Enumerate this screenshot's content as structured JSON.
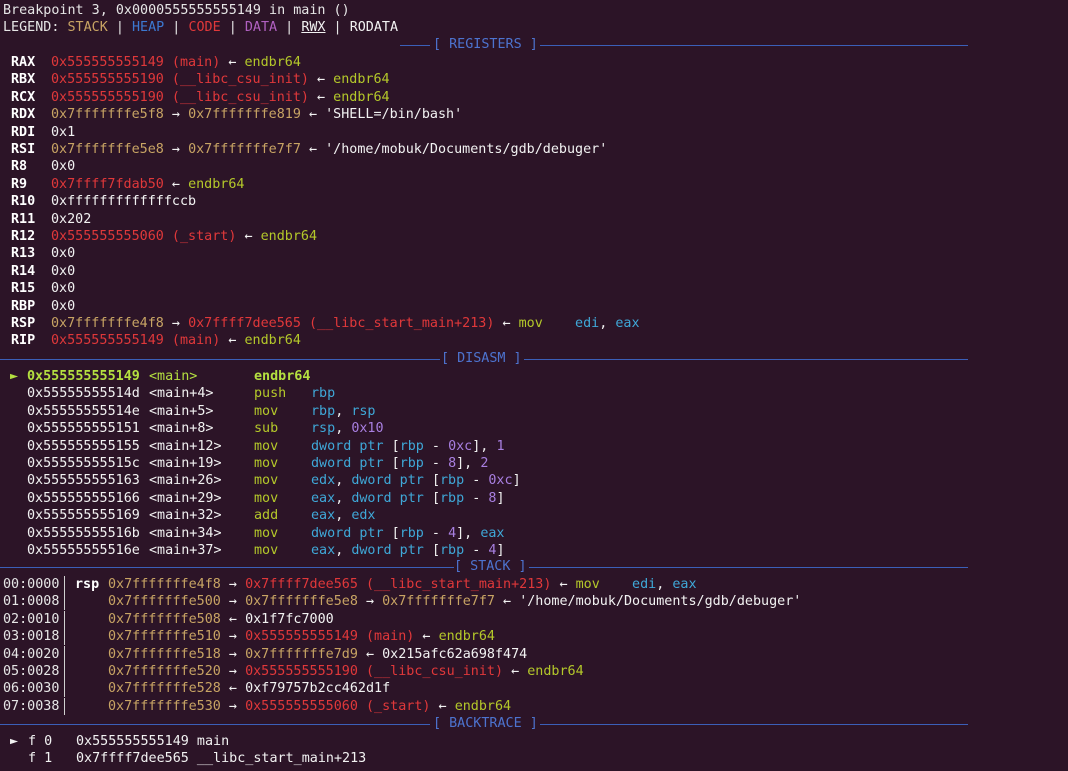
{
  "header": {
    "breakpoint_line": "Breakpoint 3, 0x0000555555555149 in main ()",
    "legend_prefix": "LEGEND: ",
    "legend": {
      "stack": "STACK",
      "heap": "HEAP",
      "code": "CODE",
      "data": "DATA",
      "rwx": "RWX",
      "rodata": "RODATA",
      "separator": " | "
    }
  },
  "sections": {
    "registers": "[ REGISTERS ]",
    "disasm": "[ DISASM ]",
    "stack": "[ STACK ]",
    "backtrace": "[ BACKTRACE ]"
  },
  "registers": [
    {
      "name": "RAX",
      "parts": [
        {
          "t": "0x555555555149 (main)",
          "c": "red"
        },
        {
          "t": " ← ",
          "c": "white"
        },
        {
          "t": "endbr64",
          "c": "green"
        }
      ]
    },
    {
      "name": "RBX",
      "parts": [
        {
          "t": "0x555555555190 (__libc_csu_init)",
          "c": "red"
        },
        {
          "t": " ← ",
          "c": "white"
        },
        {
          "t": "endbr64",
          "c": "green"
        }
      ]
    },
    {
      "name": "RCX",
      "parts": [
        {
          "t": "0x555555555190 (__libc_csu_init)",
          "c": "red"
        },
        {
          "t": " ← ",
          "c": "white"
        },
        {
          "t": "endbr64",
          "c": "green"
        }
      ]
    },
    {
      "name": "RDX",
      "parts": [
        {
          "t": "0x7fffffffe5f8",
          "c": "brown"
        },
        {
          "t": " → ",
          "c": "white"
        },
        {
          "t": "0x7fffffffe819",
          "c": "brown"
        },
        {
          "t": " ← ",
          "c": "white"
        },
        {
          "t": "'SHELL=/bin/bash'",
          "c": "white"
        }
      ]
    },
    {
      "name": "RDI",
      "parts": [
        {
          "t": "0x1",
          "c": "white"
        }
      ]
    },
    {
      "name": "RSI",
      "parts": [
        {
          "t": "0x7fffffffe5e8",
          "c": "brown"
        },
        {
          "t": " → ",
          "c": "white"
        },
        {
          "t": "0x7fffffffe7f7",
          "c": "brown"
        },
        {
          "t": " ← ",
          "c": "white"
        },
        {
          "t": "'/home/mobuk/Documents/gdb/debuger'",
          "c": "white"
        }
      ]
    },
    {
      "name": "R8",
      "parts": [
        {
          "t": "0x0",
          "c": "white"
        }
      ]
    },
    {
      "name": "R9",
      "parts": [
        {
          "t": "0x7ffff7fdab50",
          "c": "red"
        },
        {
          "t": " ← ",
          "c": "white"
        },
        {
          "t": "endbr64",
          "c": "green"
        }
      ]
    },
    {
      "name": "R10",
      "parts": [
        {
          "t": "0xfffffffffffffccb",
          "c": "white"
        }
      ]
    },
    {
      "name": "R11",
      "parts": [
        {
          "t": "0x202",
          "c": "white"
        }
      ]
    },
    {
      "name": "R12",
      "parts": [
        {
          "t": "0x555555555060 (_start)",
          "c": "red"
        },
        {
          "t": " ← ",
          "c": "white"
        },
        {
          "t": "endbr64",
          "c": "green"
        }
      ]
    },
    {
      "name": "R13",
      "parts": [
        {
          "t": "0x0",
          "c": "white"
        }
      ]
    },
    {
      "name": "R14",
      "parts": [
        {
          "t": "0x0",
          "c": "white"
        }
      ]
    },
    {
      "name": "R15",
      "parts": [
        {
          "t": "0x0",
          "c": "white"
        }
      ]
    },
    {
      "name": "RBP",
      "parts": [
        {
          "t": "0x0",
          "c": "white"
        }
      ]
    },
    {
      "name": "RSP",
      "parts": [
        {
          "t": "0x7fffffffe4f8",
          "c": "brown"
        },
        {
          "t": " → ",
          "c": "white"
        },
        {
          "t": "0x7ffff7dee565 (__libc_start_main+213)",
          "c": "red"
        },
        {
          "t": " ← ",
          "c": "white"
        },
        {
          "t": "mov",
          "c": "green"
        },
        {
          "t": "    ",
          "c": "white"
        },
        {
          "t": "edi",
          "c": "cyan"
        },
        {
          "t": ", ",
          "c": "white"
        },
        {
          "t": "eax",
          "c": "cyan"
        }
      ]
    },
    {
      "name": "RIP",
      "parts": [
        {
          "t": "0x555555555149 (main)",
          "c": "red"
        },
        {
          "t": " ← ",
          "c": "white"
        },
        {
          "t": "endbr64",
          "c": "green"
        }
      ]
    }
  ],
  "disasm": [
    {
      "current": true,
      "addr": "0x555555555149",
      "sym": "<main>",
      "mnem": "endbr64",
      "ops": []
    },
    {
      "current": false,
      "addr": "0x55555555514d",
      "sym": "<main+4>",
      "mnem": "push",
      "ops": [
        {
          "t": "rbp",
          "c": "cyan"
        }
      ]
    },
    {
      "current": false,
      "addr": "0x55555555514e",
      "sym": "<main+5>",
      "mnem": "mov",
      "ops": [
        {
          "t": "rbp",
          "c": "cyan"
        },
        {
          "t": ", ",
          "c": "white"
        },
        {
          "t": "rsp",
          "c": "cyan"
        }
      ]
    },
    {
      "current": false,
      "addr": "0x555555555151",
      "sym": "<main+8>",
      "mnem": "sub",
      "ops": [
        {
          "t": "rsp",
          "c": "cyan"
        },
        {
          "t": ", ",
          "c": "white"
        },
        {
          "t": "0x10",
          "c": "purple"
        }
      ]
    },
    {
      "current": false,
      "addr": "0x555555555155",
      "sym": "<main+12>",
      "mnem": "mov",
      "ops": [
        {
          "t": "dword ptr ",
          "c": "cyan"
        },
        {
          "t": "[",
          "c": "white"
        },
        {
          "t": "rbp",
          "c": "cyan"
        },
        {
          "t": " - ",
          "c": "white"
        },
        {
          "t": "0xc",
          "c": "purple"
        },
        {
          "t": "], ",
          "c": "white"
        },
        {
          "t": "1",
          "c": "purple"
        }
      ]
    },
    {
      "current": false,
      "addr": "0x55555555515c",
      "sym": "<main+19>",
      "mnem": "mov",
      "ops": [
        {
          "t": "dword ptr ",
          "c": "cyan"
        },
        {
          "t": "[",
          "c": "white"
        },
        {
          "t": "rbp",
          "c": "cyan"
        },
        {
          "t": " - ",
          "c": "white"
        },
        {
          "t": "8",
          "c": "purple"
        },
        {
          "t": "], ",
          "c": "white"
        },
        {
          "t": "2",
          "c": "purple"
        }
      ]
    },
    {
      "current": false,
      "addr": "0x555555555163",
      "sym": "<main+26>",
      "mnem": "mov",
      "ops": [
        {
          "t": "edx",
          "c": "cyan"
        },
        {
          "t": ", ",
          "c": "white"
        },
        {
          "t": "dword ptr ",
          "c": "cyan"
        },
        {
          "t": "[",
          "c": "white"
        },
        {
          "t": "rbp",
          "c": "cyan"
        },
        {
          "t": " - ",
          "c": "white"
        },
        {
          "t": "0xc",
          "c": "purple"
        },
        {
          "t": "]",
          "c": "white"
        }
      ]
    },
    {
      "current": false,
      "addr": "0x555555555166",
      "sym": "<main+29>",
      "mnem": "mov",
      "ops": [
        {
          "t": "eax",
          "c": "cyan"
        },
        {
          "t": ", ",
          "c": "white"
        },
        {
          "t": "dword ptr ",
          "c": "cyan"
        },
        {
          "t": "[",
          "c": "white"
        },
        {
          "t": "rbp",
          "c": "cyan"
        },
        {
          "t": " - ",
          "c": "white"
        },
        {
          "t": "8",
          "c": "purple"
        },
        {
          "t": "]",
          "c": "white"
        }
      ]
    },
    {
      "current": false,
      "addr": "0x555555555169",
      "sym": "<main+32>",
      "mnem": "add",
      "ops": [
        {
          "t": "eax",
          "c": "cyan"
        },
        {
          "t": ", ",
          "c": "white"
        },
        {
          "t": "edx",
          "c": "cyan"
        }
      ]
    },
    {
      "current": false,
      "addr": "0x55555555516b",
      "sym": "<main+34>",
      "mnem": "mov",
      "ops": [
        {
          "t": "dword ptr ",
          "c": "cyan"
        },
        {
          "t": "[",
          "c": "white"
        },
        {
          "t": "rbp",
          "c": "cyan"
        },
        {
          "t": " - ",
          "c": "white"
        },
        {
          "t": "4",
          "c": "purple"
        },
        {
          "t": "], ",
          "c": "white"
        },
        {
          "t": "eax",
          "c": "cyan"
        }
      ]
    },
    {
      "current": false,
      "addr": "0x55555555516e",
      "sym": "<main+37>",
      "mnem": "mov",
      "ops": [
        {
          "t": "eax",
          "c": "cyan"
        },
        {
          "t": ", ",
          "c": "white"
        },
        {
          "t": "dword ptr ",
          "c": "cyan"
        },
        {
          "t": "[",
          "c": "white"
        },
        {
          "t": "rbp",
          "c": "cyan"
        },
        {
          "t": " - ",
          "c": "white"
        },
        {
          "t": "4",
          "c": "purple"
        },
        {
          "t": "]",
          "c": "white"
        }
      ]
    }
  ],
  "stack": [
    {
      "off": "00:0000",
      "rsp": "rsp",
      "parts": [
        {
          "t": "0x7fffffffe4f8",
          "c": "brown"
        },
        {
          "t": " → ",
          "c": "white"
        },
        {
          "t": "0x7ffff7dee565 (__libc_start_main+213)",
          "c": "red"
        },
        {
          "t": " ← ",
          "c": "white"
        },
        {
          "t": "mov",
          "c": "green"
        },
        {
          "t": "    ",
          "c": "white"
        },
        {
          "t": "edi",
          "c": "cyan"
        },
        {
          "t": ", ",
          "c": "white"
        },
        {
          "t": "eax",
          "c": "cyan"
        }
      ]
    },
    {
      "off": "01:0008",
      "rsp": "",
      "parts": [
        {
          "t": "0x7fffffffe500",
          "c": "brown"
        },
        {
          "t": " → ",
          "c": "white"
        },
        {
          "t": "0x7fffffffe5e8",
          "c": "brown"
        },
        {
          "t": " → ",
          "c": "white"
        },
        {
          "t": "0x7fffffffe7f7",
          "c": "brown"
        },
        {
          "t": " ← ",
          "c": "white"
        },
        {
          "t": "'/home/mobuk/Documents/gdb/debuger'",
          "c": "white"
        }
      ]
    },
    {
      "off": "02:0010",
      "rsp": "",
      "parts": [
        {
          "t": "0x7fffffffe508",
          "c": "brown"
        },
        {
          "t": " ← ",
          "c": "white"
        },
        {
          "t": "0x1f7fc7000",
          "c": "white"
        }
      ]
    },
    {
      "off": "03:0018",
      "rsp": "",
      "parts": [
        {
          "t": "0x7fffffffe510",
          "c": "brown"
        },
        {
          "t": " → ",
          "c": "white"
        },
        {
          "t": "0x555555555149 (main)",
          "c": "red"
        },
        {
          "t": " ← ",
          "c": "white"
        },
        {
          "t": "endbr64",
          "c": "green"
        }
      ]
    },
    {
      "off": "04:0020",
      "rsp": "",
      "parts": [
        {
          "t": "0x7fffffffe518",
          "c": "brown"
        },
        {
          "t": " → ",
          "c": "white"
        },
        {
          "t": "0x7fffffffe7d9",
          "c": "brown"
        },
        {
          "t": " ← ",
          "c": "white"
        },
        {
          "t": "0x215afc62a698f474",
          "c": "white"
        }
      ]
    },
    {
      "off": "05:0028",
      "rsp": "",
      "parts": [
        {
          "t": "0x7fffffffe520",
          "c": "brown"
        },
        {
          "t": " → ",
          "c": "white"
        },
        {
          "t": "0x555555555190 (__libc_csu_init)",
          "c": "red"
        },
        {
          "t": " ← ",
          "c": "white"
        },
        {
          "t": "endbr64",
          "c": "green"
        }
      ]
    },
    {
      "off": "06:0030",
      "rsp": "",
      "parts": [
        {
          "t": "0x7fffffffe528",
          "c": "brown"
        },
        {
          "t": " ← ",
          "c": "white"
        },
        {
          "t": "0xf79757b2cc462d1f",
          "c": "white"
        }
      ]
    },
    {
      "off": "07:0038",
      "rsp": "",
      "parts": [
        {
          "t": "0x7fffffffe530",
          "c": "brown"
        },
        {
          "t": " → ",
          "c": "white"
        },
        {
          "t": "0x555555555060 (_start)",
          "c": "red"
        },
        {
          "t": " ← ",
          "c": "white"
        },
        {
          "t": "endbr64",
          "c": "green"
        }
      ]
    }
  ],
  "backtrace": [
    {
      "current": true,
      "frame": "f 0",
      "addr": "0x555555555149",
      "func": "main"
    },
    {
      "current": false,
      "frame": "f 1",
      "addr": "0x7ffff7dee565",
      "func": "__libc_start_main+213"
    }
  ],
  "indicator_glyph": "►"
}
